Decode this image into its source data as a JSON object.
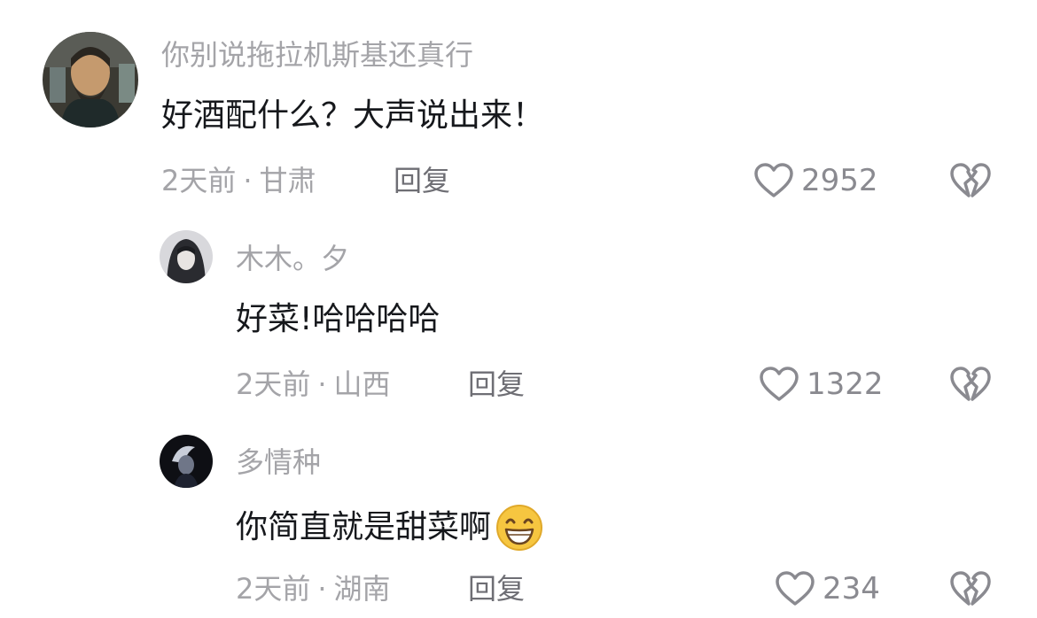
{
  "comments": [
    {
      "username": "你别说拖拉机斯基还真行",
      "text": "好酒配什么？大声说出来！",
      "time": "2天前",
      "location": "甘肃",
      "separator": "·",
      "reply_label": "回复",
      "likes": "2952",
      "avatar_icon": "bearded-man-avatar"
    },
    {
      "username": "木木。夕",
      "text": "好菜!哈哈哈哈",
      "time": "2天前",
      "location": "山西",
      "separator": "·",
      "reply_label": "回复",
      "likes": "1322",
      "avatar_icon": "hooded-figure-avatar"
    },
    {
      "username": "多情种",
      "text": "你简直就是甜菜啊",
      "time": "2天前",
      "location": "湖南",
      "separator": "·",
      "reply_label": "回复",
      "likes": "234",
      "avatar_icon": "dark-portrait-avatar",
      "emoji": "grinning-smile-emoji"
    }
  ],
  "colors": {
    "primary_text": "#16181c",
    "secondary_text": "#a4a4a8",
    "icon_stroke": "#8a8a90",
    "emoji_yellow": "#f6c640"
  }
}
